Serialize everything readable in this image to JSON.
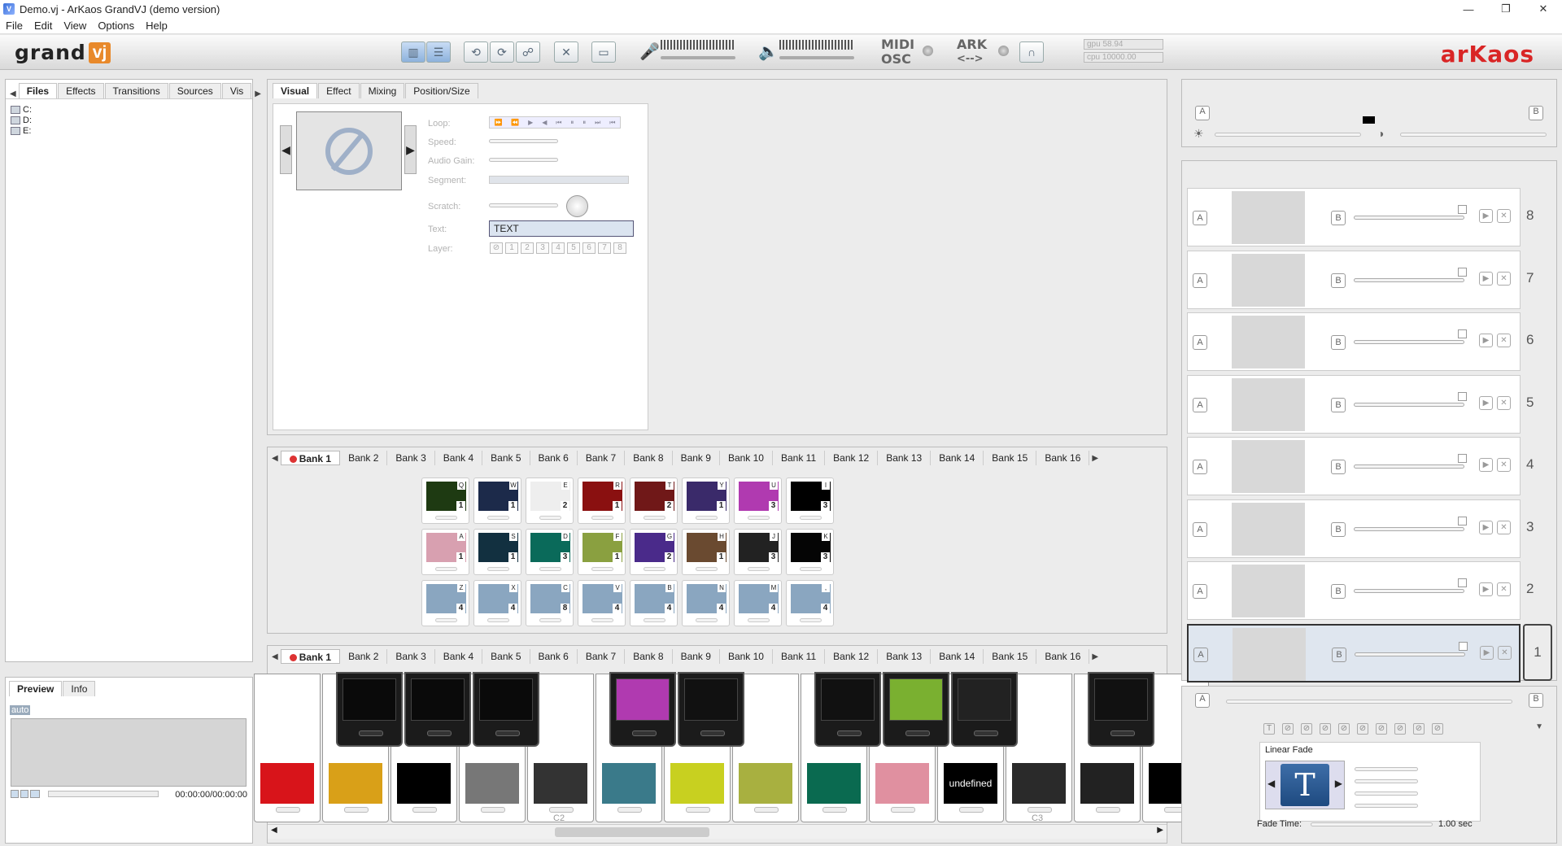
{
  "window": {
    "title": "Demo.vj - ArKaos GrandVJ (demo version)",
    "min": "—",
    "max": "❐",
    "close": "✕"
  },
  "menu": [
    "File",
    "Edit",
    "View",
    "Options",
    "Help"
  ],
  "toolbar": {
    "logo_text": "grand",
    "logo_vj": "vj",
    "midi": "MIDI",
    "osc": "OSC",
    "ark": "ARK",
    "ark_arrows": "<-->",
    "gpu": "gpu 58.94",
    "cpu": "cpu 10000.00",
    "brand": "arKaos"
  },
  "left": {
    "tabs": [
      "Files",
      "Effects",
      "Transitions",
      "Sources",
      "Vis"
    ],
    "drives": [
      "C:",
      "D:",
      "E:"
    ],
    "preview_tabs": [
      "Preview",
      "Info"
    ],
    "auto": "auto",
    "timecode": "00:00:00/00:00:00"
  },
  "inspector": {
    "tabs": [
      "Visual",
      "Effect",
      "Mixing",
      "Position/Size"
    ],
    "labels": [
      "Loop:",
      "Speed:",
      "Audio Gain:",
      "Segment:",
      "Scratch:",
      "Text:",
      "Layer:"
    ],
    "text_value": "TEXT",
    "layer_buttons": [
      "⊘",
      "1",
      "2",
      "3",
      "4",
      "5",
      "6",
      "7",
      "8"
    ]
  },
  "banks": [
    "Bank 1",
    "Bank 2",
    "Bank 3",
    "Bank 4",
    "Bank 5",
    "Bank 6",
    "Bank 7",
    "Bank 8",
    "Bank 9",
    "Bank 10",
    "Bank 11",
    "Bank 12",
    "Bank 13",
    "Bank 14",
    "Bank 15",
    "Bank 16"
  ],
  "clips": [
    {
      "k": "Q",
      "n": "1",
      "c": "#1e3a12"
    },
    {
      "k": "W",
      "n": "1",
      "c": "#1c2a4a"
    },
    {
      "k": "E",
      "n": "2",
      "c": "#eeeeee"
    },
    {
      "k": "R",
      "n": "1",
      "c": "#8a1010"
    },
    {
      "k": "T",
      "n": "2",
      "c": "#701818"
    },
    {
      "k": "Y",
      "n": "1",
      "c": "#3a2a6a"
    },
    {
      "k": "U",
      "n": "3",
      "c": "#b03ab0"
    },
    {
      "k": "I",
      "n": "3",
      "c": "#000000"
    },
    {
      "k": "A",
      "n": "1",
      "c": "#d8a0b0"
    },
    {
      "k": "S",
      "n": "1",
      "c": "#123040"
    },
    {
      "k": "D",
      "n": "3",
      "c": "#0a6a5a"
    },
    {
      "k": "F",
      "n": "1",
      "c": "#8aa040"
    },
    {
      "k": "G",
      "n": "2",
      "c": "#4a2a8a"
    },
    {
      "k": "H",
      "n": "1",
      "c": "#6a4a30"
    },
    {
      "k": "J",
      "n": "3",
      "c": "#222222"
    },
    {
      "k": "K",
      "n": "3",
      "c": "#050505"
    },
    {
      "k": "Z",
      "n": "4",
      "c": "#8aa6c0"
    },
    {
      "k": "X",
      "n": "4",
      "c": "#8aa6c0"
    },
    {
      "k": "C",
      "n": "8",
      "c": "#8aa6c0"
    },
    {
      "k": "V",
      "n": "4",
      "c": "#8aa6c0"
    },
    {
      "k": "B",
      "n": "4",
      "c": "#8aa6c0"
    },
    {
      "k": "N",
      "n": "4",
      "c": "#8aa6c0"
    },
    {
      "k": "M",
      "n": "4",
      "c": "#8aa6c0"
    },
    {
      "k": ",",
      "n": "4",
      "c": "#8aa6c0"
    }
  ],
  "keyboard": {
    "octaves": [
      "C2",
      "C3"
    ],
    "white_colors": [
      "#d8141a",
      "#d9a018",
      "#000000",
      "#777777",
      "#333333",
      "#3a7a8a",
      "#c8d020",
      "#a8b040",
      "#0a6a50",
      "#e090a0",
      "#000000",
      "#2a2a2a",
      "#222222",
      "#000000"
    ],
    "white_labels": [
      "",
      "",
      "",
      "",
      "",
      "",
      "",
      "",
      "",
      "",
      "undefined",
      "",
      "",
      ""
    ],
    "black_colors": [
      "#0a0a0a",
      "#0a0a0a",
      "#0a0a0a",
      "#b03ab0",
      "#111111",
      "#111111",
      "#7ab030",
      "#222222",
      "#111111"
    ]
  },
  "mixer": {
    "a": "A",
    "b": "B"
  },
  "layers": [
    "8",
    "7",
    "6",
    "5",
    "4",
    "3",
    "2",
    "1"
  ],
  "transition": {
    "title": "Linear Fade",
    "glyph": "T",
    "fade_label": "Fade Time:",
    "fade_value": "1.00 sec"
  }
}
